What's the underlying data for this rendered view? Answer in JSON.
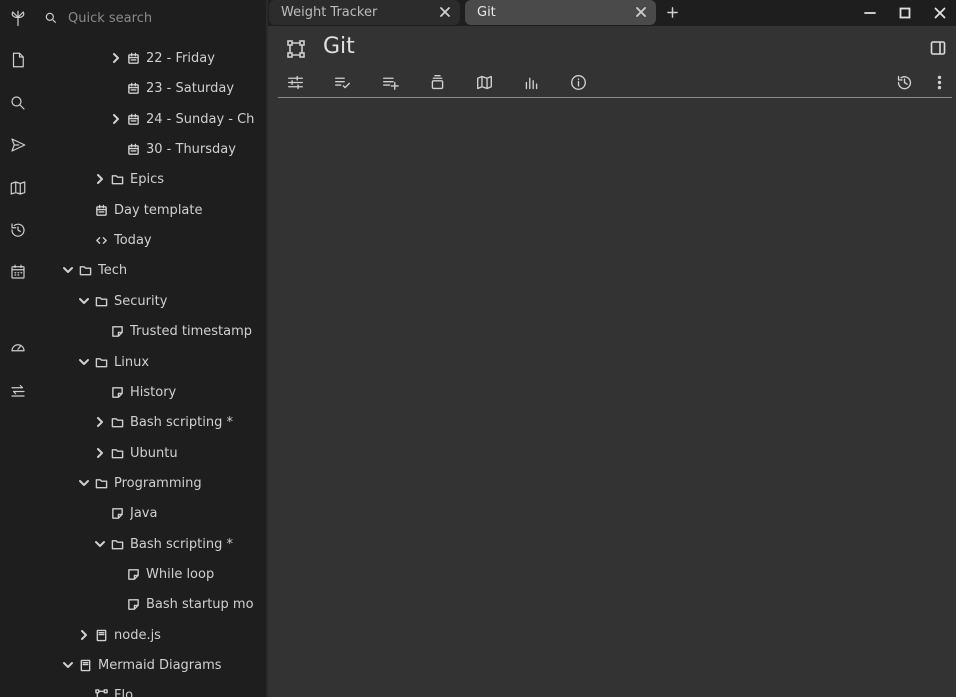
{
  "search": {
    "placeholder": "Quick search"
  },
  "launcher": {
    "items": [
      {
        "icon": "tree-logo-icon"
      },
      {
        "icon": "new-note-icon"
      },
      {
        "icon": "search-icon"
      },
      {
        "icon": "send-icon"
      },
      {
        "icon": "map-icon"
      },
      {
        "icon": "history-icon"
      },
      {
        "icon": "calendar-icon"
      },
      {
        "icon": "gauge-icon"
      },
      {
        "icon": "sync-icon"
      }
    ]
  },
  "tree": {
    "items": [
      {
        "label": "22 - Friday",
        "depth": 4,
        "chevron": "right",
        "icon": "calendar-icon"
      },
      {
        "label": "23 - Saturday",
        "depth": 4,
        "chevron": "none",
        "icon": "calendar-icon"
      },
      {
        "label": "24 - Sunday - Ch",
        "depth": 4,
        "chevron": "right",
        "icon": "calendar-icon"
      },
      {
        "label": "30 - Thursday",
        "depth": 4,
        "chevron": "none",
        "icon": "calendar-icon"
      },
      {
        "label": "Epics",
        "depth": 3,
        "chevron": "right",
        "icon": "folder-icon"
      },
      {
        "label": "Day template",
        "depth": 2,
        "chevron": "none",
        "icon": "calendar-icon"
      },
      {
        "label": "Today",
        "depth": 2,
        "chevron": "none",
        "icon": "code-icon"
      },
      {
        "label": "Tech",
        "depth": 1,
        "chevron": "down",
        "icon": "folder-icon"
      },
      {
        "label": "Security",
        "depth": 2,
        "chevron": "down",
        "icon": "folder-icon"
      },
      {
        "label": "Trusted timestamp",
        "depth": 3,
        "chevron": "none",
        "icon": "note-icon"
      },
      {
        "label": "Linux",
        "depth": 2,
        "chevron": "down",
        "icon": "folder-icon"
      },
      {
        "label": "History",
        "depth": 3,
        "chevron": "none",
        "icon": "note-icon"
      },
      {
        "label": "Bash scripting *",
        "depth": 3,
        "chevron": "right",
        "icon": "folder-icon"
      },
      {
        "label": "Ubuntu",
        "depth": 3,
        "chevron": "right",
        "icon": "folder-icon"
      },
      {
        "label": "Programming",
        "depth": 2,
        "chevron": "down",
        "icon": "folder-icon"
      },
      {
        "label": "Java",
        "depth": 3,
        "chevron": "none",
        "icon": "note-icon"
      },
      {
        "label": "Bash scripting *",
        "depth": 3,
        "chevron": "down",
        "icon": "folder-icon"
      },
      {
        "label": "While loop",
        "depth": 4,
        "chevron": "none",
        "icon": "note-icon"
      },
      {
        "label": "Bash startup mo",
        "depth": 4,
        "chevron": "none",
        "icon": "note-icon"
      },
      {
        "label": "node.js",
        "depth": 2,
        "chevron": "right",
        "icon": "book-icon"
      },
      {
        "label": "Mermaid Diagrams",
        "depth": 1,
        "chevron": "down",
        "icon": "book-icon"
      },
      {
        "label": "Flo",
        "depth": 2,
        "chevron": "none",
        "icon": "diagram-icon"
      }
    ]
  },
  "tabs": [
    {
      "label": "Weight Tracker",
      "active": false
    },
    {
      "label": "Git",
      "active": true
    }
  ],
  "note": {
    "title": "Git",
    "type_icon": "diagram-icon"
  },
  "ribbon": {
    "items": [
      {
        "icon": "properties-icon"
      },
      {
        "icon": "checklist-icon"
      },
      {
        "icon": "add-list-icon"
      },
      {
        "icon": "stack-icon"
      },
      {
        "icon": "note-map-icon"
      },
      {
        "icon": "stats-icon"
      },
      {
        "icon": "info-icon"
      },
      {
        "icon": "revision-history-icon"
      },
      {
        "icon": "more-vert-icon"
      }
    ]
  },
  "colors": {
    "background": "#1e1e1e",
    "main": "#333333",
    "active_tab": "#4a4a4a",
    "text": "#d0d0d0"
  }
}
